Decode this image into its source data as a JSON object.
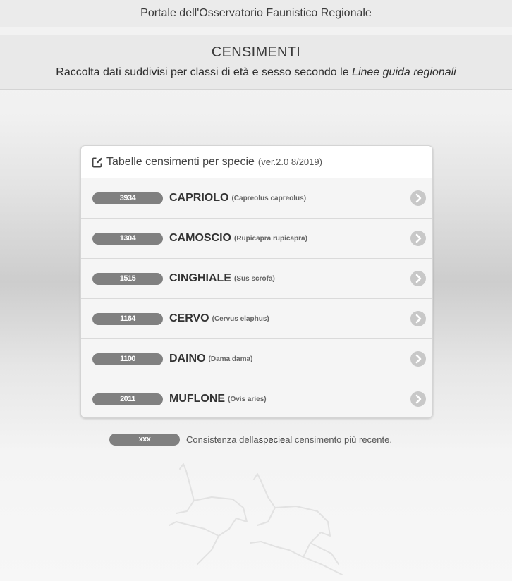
{
  "topbar": {
    "title": "Portale dell'Osservatorio Faunistico Regionale"
  },
  "header": {
    "title": "CENSIMENTI",
    "subtitle_prefix": "Raccolta dati suddivisi per classi di età e sesso secondo le ",
    "subtitle_emphasis": "Linee guida regionali"
  },
  "card": {
    "title": "Tabelle censimenti per specie",
    "version": "(ver.2.0 8/2019)",
    "icon": "edit-icon",
    "rows": [
      {
        "count": "3934",
        "name": "CAPRIOLO",
        "latin": "(Capreolus capreolus)"
      },
      {
        "count": "1304",
        "name": "CAMOSCIO",
        "latin": "(Rupicapra rupicapra)"
      },
      {
        "count": "1515",
        "name": "CINGHIALE",
        "latin": "(Sus scrofa)"
      },
      {
        "count": "1164",
        "name": "CERVO",
        "latin": "(Cervus elaphus)"
      },
      {
        "count": "1100",
        "name": "DAINO",
        "latin": "(Dama dama)"
      },
      {
        "count": "2011",
        "name": "MUFLONE",
        "latin": "(Ovis aries)"
      }
    ]
  },
  "legend": {
    "badge": "xxx",
    "text_before": "Consistenza della ",
    "text_strong": "specie",
    "text_after": " al censimento più recente."
  },
  "colors": {
    "badge": "#808080",
    "chevron": "#c8c8c8"
  }
}
